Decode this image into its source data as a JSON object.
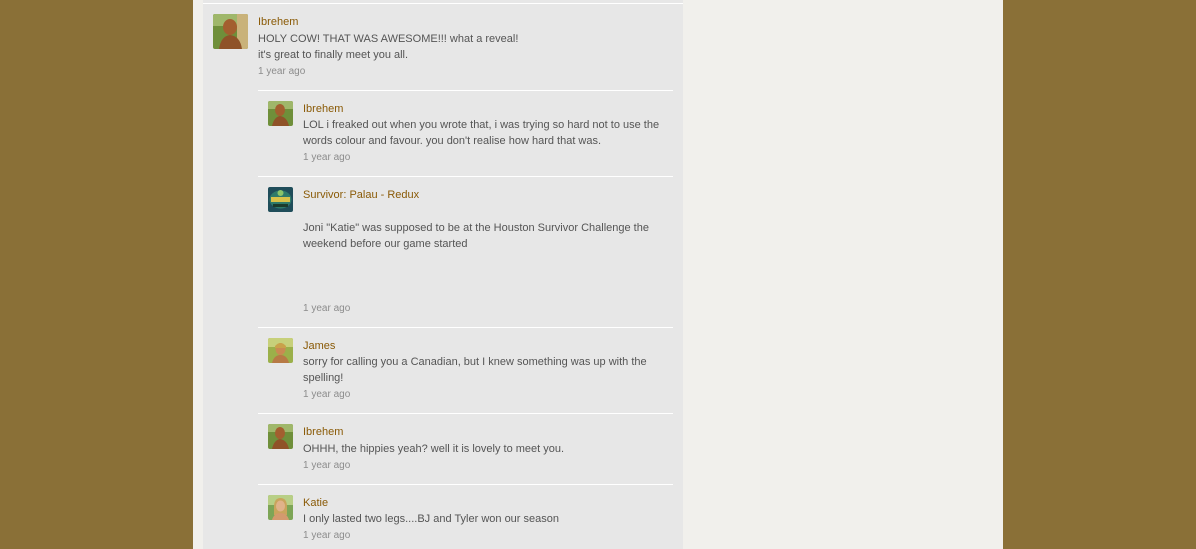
{
  "colors": {
    "outer_background": "#8a7037",
    "page_background": "#f1f0ec",
    "stream_background": "#e7e7e7",
    "author_link": "#8a5a06",
    "body_text": "#555555",
    "timestamp": "#8c8c8c"
  },
  "main_post": {
    "author": "Ibrehem",
    "lines": [
      "HOLY COW! THAT WAS AWESOME!!! what a reveal!",
      "it's great to finally meet you all."
    ],
    "time": "1 year ago",
    "avatar": "ibrehem-avatar"
  },
  "replies": [
    {
      "author": "Ibrehem",
      "lines": [
        "LOL i freaked out when you wrote that, i was trying so hard not to use the",
        "words colour and favour. you don't realise how hard that was."
      ],
      "time": "1 year ago",
      "avatar": "ibrehem-avatar"
    },
    {
      "author": "Survivor: Palau - Redux",
      "lines": [
        "Joni \"Katie\" was supposed to be at the Houston Survivor Challenge the",
        "weekend before our game started"
      ],
      "time": "1 year ago",
      "avatar": "survivor-logo-avatar"
    },
    {
      "author": "James",
      "lines": [
        "sorry for calling you a Canadian, but I knew something was up with the",
        "spelling!"
      ],
      "time": "1 year ago",
      "avatar": "james-avatar"
    },
    {
      "author": "Ibrehem",
      "lines": [
        "OHHH, the hippies yeah? well it is lovely to meet you."
      ],
      "time": "1 year ago",
      "avatar": "ibrehem-avatar"
    },
    {
      "author": "Katie",
      "lines": [
        "I only lasted two legs....BJ and Tyler won our season"
      ],
      "time": "1 year ago",
      "avatar": "katie-avatar"
    }
  ]
}
